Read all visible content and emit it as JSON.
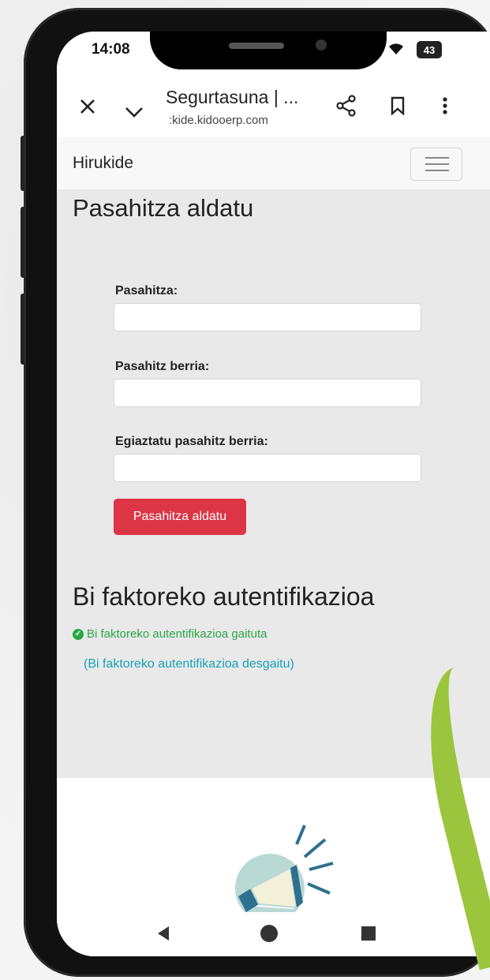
{
  "status_bar": {
    "time": "14:08",
    "battery": "43"
  },
  "browser": {
    "tab_title": "Segurtasuna | ...",
    "url": ":kide.kidooerp.com"
  },
  "navbar": {
    "brand": "Hirukide"
  },
  "password_section": {
    "title": "Pasahitza aldatu",
    "current_label": "Pasahitza:",
    "new_label": "Pasahitz berria:",
    "confirm_label": "Egiaztatu pasahitz berria:",
    "submit_label": "Pasahitza aldatu"
  },
  "two_factor": {
    "title": "Bi faktoreko autentifikazioa",
    "status": "Bi faktoreko autentifikazioa gaituta",
    "disable_link": "(Bi faktoreko autentifikazioa desgaitu)"
  },
  "icons": {
    "close": "close-icon",
    "tabs": "chevron-down-icon",
    "share": "share-icon",
    "bookmark": "bookmark-icon",
    "menu": "more-vert-icon",
    "status_ok": "check-circle-icon",
    "megaphone": "megaphone-icon"
  },
  "colors": {
    "primary_button": "#dc3545",
    "success": "#28a745",
    "link": "#17a2b8",
    "leaf": "#9bc53d"
  }
}
